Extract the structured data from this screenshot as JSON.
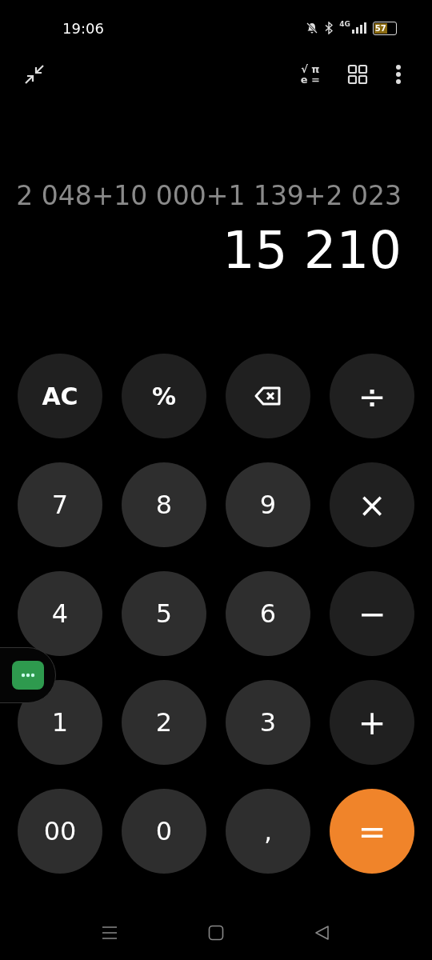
{
  "status_bar": {
    "time": "19:06",
    "network": "4G",
    "battery": "57"
  },
  "toolbar": {
    "scientific_toggle": [
      "√ π",
      "e ="
    ]
  },
  "display": {
    "expression": "2 048+10 000+1 139+2 023",
    "result": "15 210"
  },
  "keys": [
    {
      "kind": "function",
      "label": "AC"
    },
    {
      "kind": "function",
      "label": "%"
    },
    {
      "kind": "backspace"
    },
    {
      "kind": "operator",
      "label": "÷"
    },
    {
      "kind": "digit",
      "label": "7"
    },
    {
      "kind": "digit",
      "label": "8"
    },
    {
      "kind": "digit",
      "label": "9"
    },
    {
      "kind": "operator",
      "label": "×"
    },
    {
      "kind": "digit",
      "label": "4"
    },
    {
      "kind": "digit",
      "label": "5"
    },
    {
      "kind": "digit",
      "label": "6"
    },
    {
      "kind": "operator",
      "label": "−"
    },
    {
      "kind": "digit",
      "label": "1"
    },
    {
      "kind": "digit",
      "label": "2"
    },
    {
      "kind": "digit",
      "label": "3"
    },
    {
      "kind": "operator",
      "label": "+"
    },
    {
      "kind": "digit",
      "label": "00"
    },
    {
      "kind": "digit",
      "label": "0"
    },
    {
      "kind": "digit",
      "label": ","
    },
    {
      "kind": "equals",
      "label": "="
    }
  ]
}
